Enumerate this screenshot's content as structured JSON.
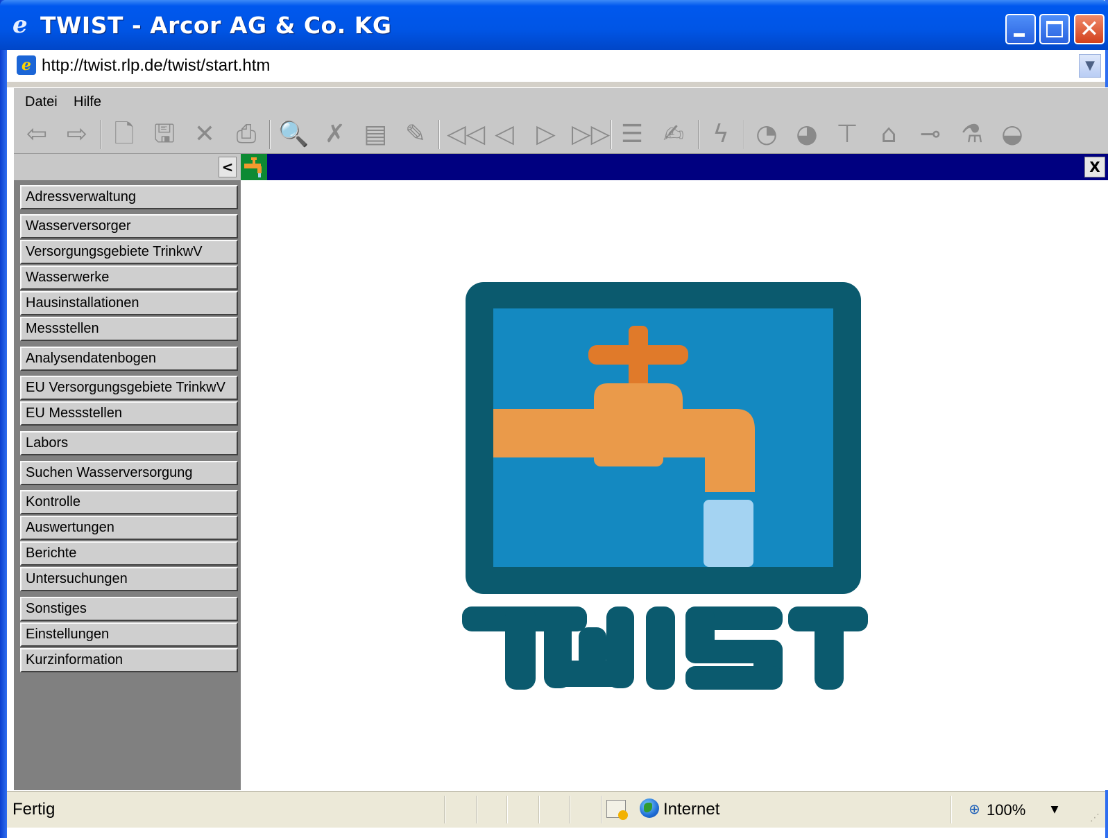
{
  "window": {
    "title": "TWIST - Arcor AG & Co. KG",
    "url": "http://twist.rlp.de/twist/start.htm"
  },
  "menubar": {
    "items": [
      "Datei",
      "Hilfe"
    ]
  },
  "toolbar": {
    "icons": [
      "back-arrow-icon",
      "forward-arrow-icon",
      "new-document-icon",
      "save-disk-icon",
      "delete-x-icon",
      "print-icon",
      "search-preview-icon",
      "qbe-delete-icon",
      "qbe-document-icon",
      "qbe-edit-icon",
      "first-record-icon",
      "previous-record-icon",
      "next-record-icon",
      "last-record-icon",
      "list-icon",
      "edit-form-icon",
      "lightning-icon",
      "pie-chart-icon",
      "pie-chart-2-icon",
      "filter-icon",
      "house-icon",
      "faucet-icon",
      "flask-icon",
      "dish-icon"
    ]
  },
  "sidebar": {
    "collapse_label": "<",
    "items": [
      "Adressverwaltung",
      "Wasserversorger",
      "Versorgungsgebiete TrinkwV",
      "Wasserwerke",
      "Hausinstallationen",
      "Messstellen",
      "Analysendatenbogen",
      "EU Versorgungsgebiete TrinkwV",
      "EU Messstellen",
      "Labors",
      "Suchen Wasserversorgung",
      "Kontrolle",
      "Auswertungen",
      "Berichte",
      "Untersuchungen",
      "Sonstiges",
      "Einstellungen",
      "Kurzinformation"
    ]
  },
  "content": {
    "close_label": "X",
    "logo_text": "TWIST"
  },
  "statusbar": {
    "status": "Fertig",
    "zone": "Internet",
    "zoom": "100%"
  },
  "colors": {
    "title_blue": "#0055e5",
    "header_navy": "#000080",
    "logo_teal": "#0b5a6e",
    "logo_water_blue": "#1489c1",
    "faucet_orange": "#ea9a4a",
    "handle_orange": "#e07a2a",
    "stream_lightblue": "#a4d3f2"
  }
}
